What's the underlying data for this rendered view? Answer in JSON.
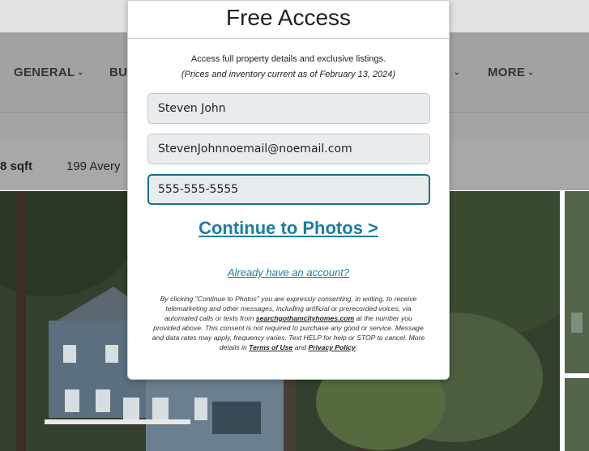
{
  "nav": {
    "items": [
      {
        "label": "GENERAL",
        "chevron": "chevron-down-icon"
      },
      {
        "label": "BU"
      },
      {
        "label": "",
        "chevron": "chevron-down-icon"
      },
      {
        "label": "MORE",
        "chevron": "chevron-down-icon"
      }
    ],
    "chevron_glyph": "⌄"
  },
  "listing": {
    "sqft": "8 sqft",
    "address": "199 Avery"
  },
  "modal": {
    "title": "Free Access",
    "intro": "Access full property details and exclusive listings.",
    "note": "(Prices and inventory current as of February 13, 2024)",
    "fields": {
      "name": "Steven John",
      "email": "StevenJohnnoemail@noemail.com",
      "phone": "555-555-5555"
    },
    "continue_label": "Continue to Photos >",
    "account_link": "Already have an account?",
    "consent": {
      "part1": "By clicking \"Continue to Photos\" you are expressly consenting, in writing, to receive telemarketing and other messages, including artificial or prerecorded voices, via automated calls or texts from ",
      "site_link": "searchgothamcityhomes.com",
      "part2": " at the number you provided above. This consent is not required to purchase any good or service. Message and data rates may apply, frequency varies. Text HELP for help or STOP to cancel. More details in ",
      "terms_link": "Terms of Use",
      "and": " and ",
      "privacy_link": "Privacy Policy",
      "end": "."
    }
  },
  "colors": {
    "accent": "#1a7fa0",
    "active_border": "#1a6f86",
    "field_bg": "#e9ecef"
  }
}
